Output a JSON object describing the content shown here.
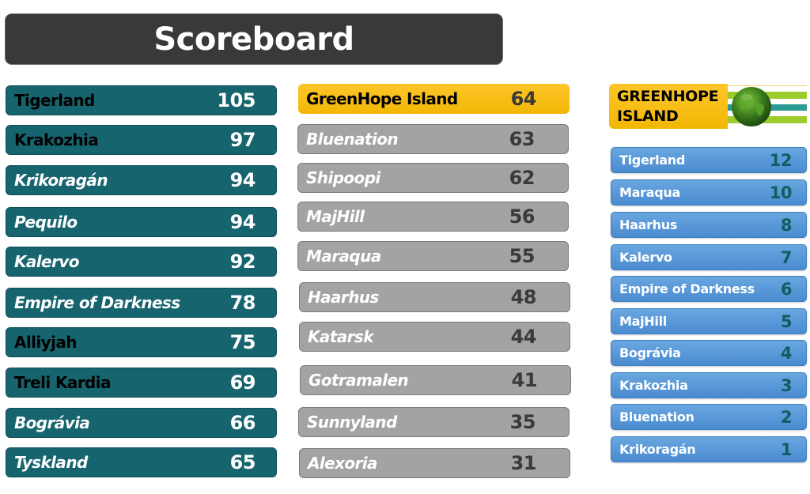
{
  "title": "Scoreboard",
  "colors": {
    "left_bar": "#16646e",
    "mid_bar": "#a3a3a3",
    "highlight_bar": "#f8bf16",
    "vote_bar": "#5a9ad8",
    "vote_score": "#0e5f63"
  },
  "left_column": [
    {
      "name": "Tigerland",
      "score": "105",
      "style": "black"
    },
    {
      "name": "Krakozhia",
      "score": "97",
      "style": "black"
    },
    {
      "name": "Krikoragán",
      "score": "94",
      "style": "white"
    },
    {
      "name": "Pequilo",
      "score": "94",
      "style": "white"
    },
    {
      "name": "Kalervo",
      "score": "92",
      "style": "white"
    },
    {
      "name": "Empire of Darkness",
      "score": "78",
      "style": "white"
    },
    {
      "name": "Alliyjah",
      "score": "75",
      "style": "black"
    },
    {
      "name": "Treli Kardia",
      "score": "69",
      "style": "black"
    },
    {
      "name": "Bográvia",
      "score": "66",
      "style": "white"
    },
    {
      "name": "Tyskland",
      "score": "65",
      "style": "white"
    }
  ],
  "middle_column": [
    {
      "name": "GreenHope Island",
      "score": "64",
      "highlight": true
    },
    {
      "name": "Bluenation",
      "score": "63"
    },
    {
      "name": "Shipoopi",
      "score": "62"
    },
    {
      "name": "MajHill",
      "score": "56"
    },
    {
      "name": "Maraqua",
      "score": "55"
    },
    {
      "name": "Haarhus",
      "score": "48"
    },
    {
      "name": "Katarsk",
      "score": "44"
    },
    {
      "name": "Gotramalen",
      "score": "41"
    },
    {
      "name": "Sunnyland",
      "score": "35"
    },
    {
      "name": "Alexoria",
      "score": "31"
    }
  ],
  "voting_panel": {
    "country_line1": "GREENHOPE",
    "country_line2": "ISLAND",
    "flag_icon": "greenhope-flag-globe",
    "votes": [
      {
        "name": "Tigerland",
        "points": "12"
      },
      {
        "name": "Maraqua",
        "points": "10"
      },
      {
        "name": "Haarhus",
        "points": "8"
      },
      {
        "name": "Kalervo",
        "points": "7"
      },
      {
        "name": "Empire of Darkness",
        "points": "6"
      },
      {
        "name": "MajHill",
        "points": "5"
      },
      {
        "name": "Bográvia",
        "points": "4"
      },
      {
        "name": "Krakozhia",
        "points": "3"
      },
      {
        "name": "Bluenation",
        "points": "2"
      },
      {
        "name": "Krikoragán",
        "points": "1"
      }
    ]
  }
}
